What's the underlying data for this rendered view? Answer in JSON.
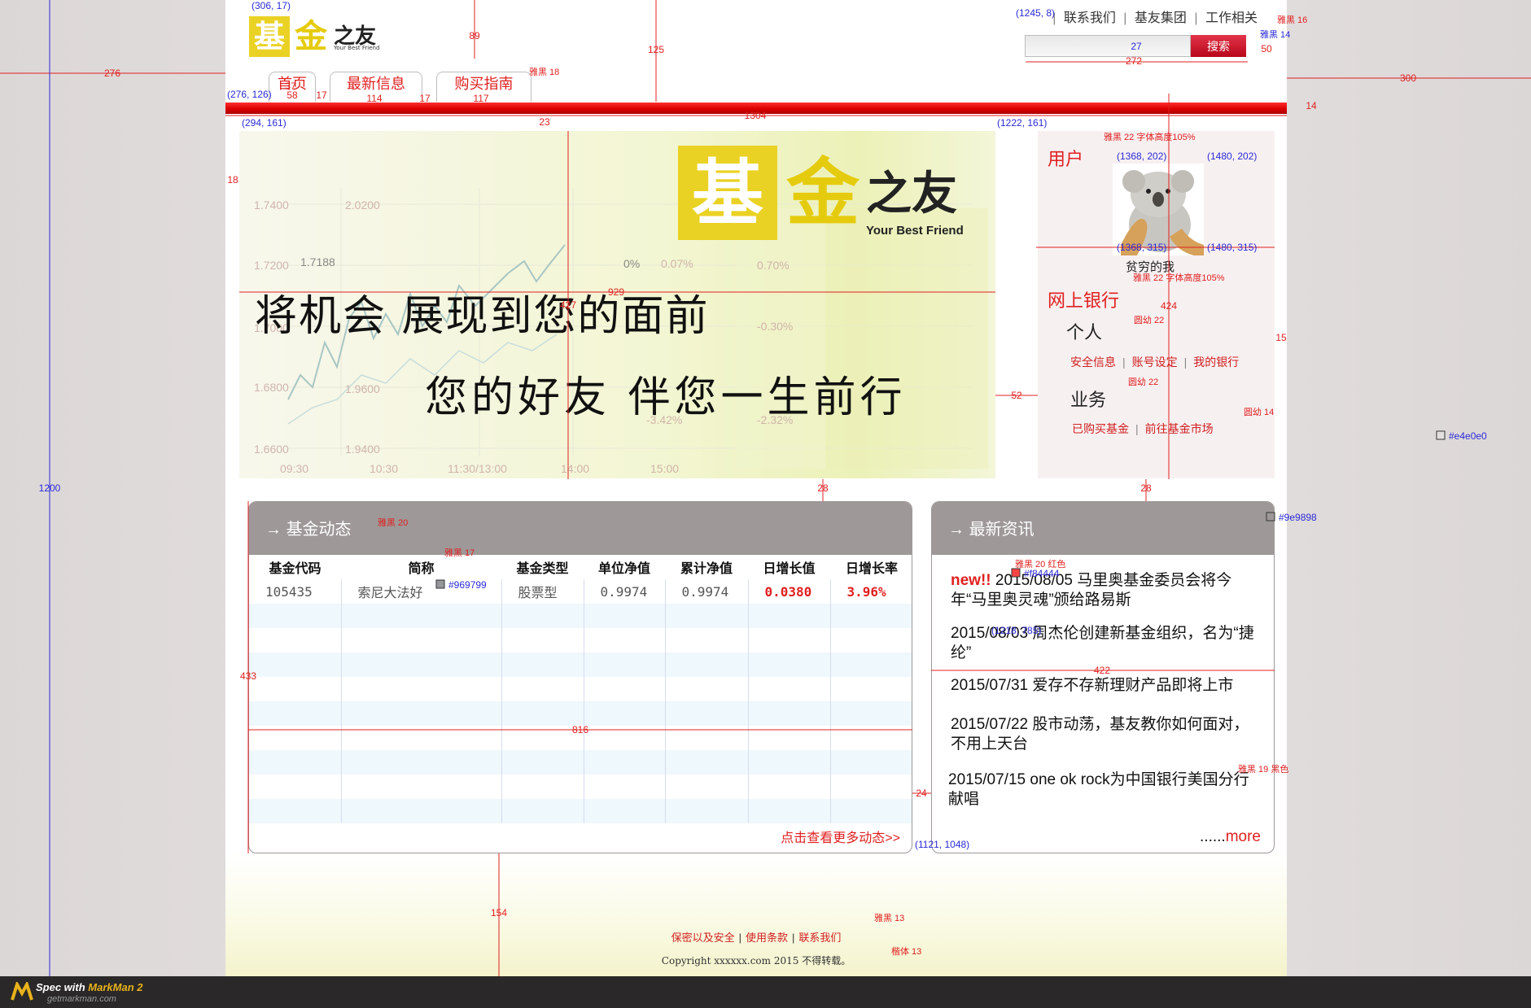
{
  "header": {
    "logo": {
      "mark": "基",
      "gold": "金",
      "zhi": "之友",
      "tagline": "Your Best Friend"
    },
    "top_links": [
      "联系我们",
      "基友集团",
      "工作相关"
    ],
    "search": {
      "placeholder": "",
      "button": "搜索"
    },
    "nav": [
      "首页",
      "最新信息",
      "购买指南"
    ]
  },
  "banner": {
    "logo": {
      "mark": "基",
      "gold": "金",
      "zhi": "之友",
      "tagline": "Your Best Friend"
    },
    "slogan_line1": "将机会 展现到您的面前",
    "slogan_line2": "您的好友 伴您一生前行",
    "chart_values": [
      "1.7400",
      "1.7200",
      "1.7188",
      "1.7000",
      "1.6800",
      "1.6600",
      "2.0200",
      "1.9600",
      "1.9400",
      "0%",
      "0.07%",
      "0.70%",
      "-0.30%",
      "-3.42%",
      "-2.32%",
      "09:30",
      "10:30",
      "11:30/13:00",
      "14:00",
      "15:00"
    ]
  },
  "user_panel": {
    "title": "用户",
    "avatar_name": "贫穷的我",
    "bank_title": "网上银行",
    "personal": "个人",
    "personal_links": [
      "安全信息",
      "账号设定",
      "我的银行"
    ],
    "business": "业务",
    "business_links": [
      "已购买基金",
      "前往基金市场"
    ]
  },
  "fund_box": {
    "title": "基金动态",
    "columns": [
      "基金代码",
      "简称",
      "基金类型",
      "单位净值",
      "累计净值",
      "日增长值",
      "日增长率"
    ],
    "rows": [
      [
        "105435",
        "索尼大法好",
        "股票型",
        "0.9974",
        "0.9974",
        "0.0380",
        "3.96%"
      ]
    ],
    "more": "点击查看更多动态>>"
  },
  "news_box": {
    "title": "最新资讯",
    "new_badge": "new!!",
    "items": [
      "2015/08/05 马里奥基金委员会将今年“马里奥灵魂”颁给路易斯",
      "2015/08/03 周杰伦创建新基金组织，名为“捷纶”",
      "2015/07/31 爱存不存新理财产品即将上市",
      "2015/07/22 股市动荡，基友教你如何面对，不用上天台",
      "2015/07/15 one ok rock为中国银行美国分行献唱"
    ],
    "more_dots": "......",
    "more": "more"
  },
  "footer": {
    "links": [
      "保密以及安全",
      "使用条款",
      "联系我们"
    ],
    "copyright": "Copyright xxxxxx.com 2015 不得转载。"
  },
  "markman": {
    "label_prefix": "Spec with ",
    "label_brand": "MarkMan 2",
    "url": "getmarkman.com"
  },
  "annotations": {
    "coords": [
      "(306, 17)",
      "(276, 126)",
      "(294, 161)",
      "(1222, 161)",
      "(1368, 202)",
      "(1480, 202)",
      "(1368, 315)",
      "(1480, 315)",
      "(1218, 785)",
      "(1121, 1048)",
      "(1245, 8)"
    ],
    "sizes": [
      "276",
      "89",
      "125",
      "27",
      "50",
      "272",
      "300",
      "14",
      "1304",
      "23",
      "18",
      "929",
      "427",
      "424",
      "15",
      "52",
      "28",
      "28",
      "433",
      "816",
      "422",
      "24",
      "154",
      "1200",
      "37",
      "58",
      "17",
      "114",
      "17",
      "117"
    ],
    "fonts": [
      "雅黑 16",
      "雅黑 14",
      "雅黑 18",
      "雅黑 22 字体高度105%",
      "雅黑 22 字体高度105%",
      "圆幼 22",
      "圆幼 22",
      "圆幼 14",
      "雅黑 20",
      "雅黑 17",
      "雅黑 20 红色",
      "雅黑 19 黑色",
      "雅黑 13",
      "楷体 13"
    ],
    "colors": [
      "#e4e0e0",
      "#9e9898",
      "#969799",
      "#f84444"
    ]
  }
}
